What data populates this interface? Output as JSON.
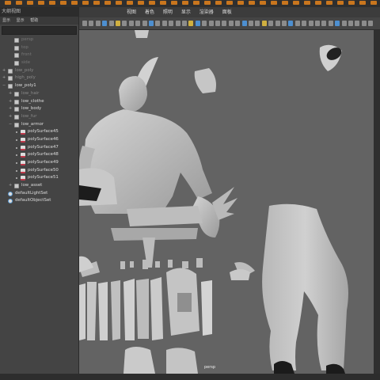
{
  "outliner": {
    "title": "大纲视图",
    "menu": [
      "显示",
      "显示",
      "帮助"
    ],
    "items": [
      {
        "label": "persp",
        "level": 1,
        "kind": "cam",
        "state": "hidden"
      },
      {
        "label": "top",
        "level": 1,
        "kind": "cam",
        "state": "hidden"
      },
      {
        "label": "front",
        "level": 1,
        "kind": "cam",
        "state": "hidden"
      },
      {
        "label": "side",
        "level": 1,
        "kind": "cam",
        "state": "hidden"
      },
      {
        "label": "low_poly",
        "level": 0,
        "kind": "grp",
        "state": "dim",
        "expander": "+"
      },
      {
        "label": "high_poly",
        "level": 0,
        "kind": "grp",
        "state": "dim",
        "expander": "+"
      },
      {
        "label": "low_poly1",
        "level": 0,
        "kind": "grp",
        "state": "normal",
        "expander": "−"
      },
      {
        "label": "low_hair",
        "level": 1,
        "kind": "grp",
        "state": "dim",
        "expander": "+"
      },
      {
        "label": "low_clothe",
        "level": 1,
        "kind": "grp",
        "state": "normal",
        "expander": "+"
      },
      {
        "label": "low_body",
        "level": 1,
        "kind": "grp",
        "state": "normal",
        "expander": "+"
      },
      {
        "label": "low_fur",
        "level": 1,
        "kind": "grp",
        "state": "dim",
        "expander": "+"
      },
      {
        "label": "low_armor",
        "level": 1,
        "kind": "grp",
        "state": "normal",
        "expander": "−"
      },
      {
        "label": "polySurface45",
        "level": 2,
        "kind": "mesh",
        "state": "normal"
      },
      {
        "label": "polySurface46",
        "level": 2,
        "kind": "mesh",
        "state": "normal"
      },
      {
        "label": "polySurface47",
        "level": 2,
        "kind": "mesh",
        "state": "normal"
      },
      {
        "label": "polySurface48",
        "level": 2,
        "kind": "mesh",
        "state": "normal"
      },
      {
        "label": "polySurface49",
        "level": 2,
        "kind": "mesh",
        "state": "normal"
      },
      {
        "label": "polySurface50",
        "level": 2,
        "kind": "mesh",
        "state": "normal"
      },
      {
        "label": "polySurface51",
        "level": 2,
        "kind": "mesh",
        "state": "normal"
      },
      {
        "label": "low_asset",
        "level": 1,
        "kind": "grp",
        "state": "normal",
        "expander": "+"
      },
      {
        "label": "defaultLightSet",
        "level": 0,
        "kind": "set",
        "state": "normal"
      },
      {
        "label": "defaultObjectSet",
        "level": 0,
        "kind": "set",
        "state": "normal"
      }
    ]
  },
  "viewport": {
    "menu": [
      "视图",
      "着色",
      "照明",
      "显示",
      "渲染器",
      "面板"
    ],
    "camera_label": "persp"
  },
  "colors": {
    "accent": "#c9761e",
    "viewport_bg": "#636363",
    "model": "#c4c4c4",
    "mesh_icon": "#c0394b",
    "set_icon": "#5a9bd4"
  }
}
